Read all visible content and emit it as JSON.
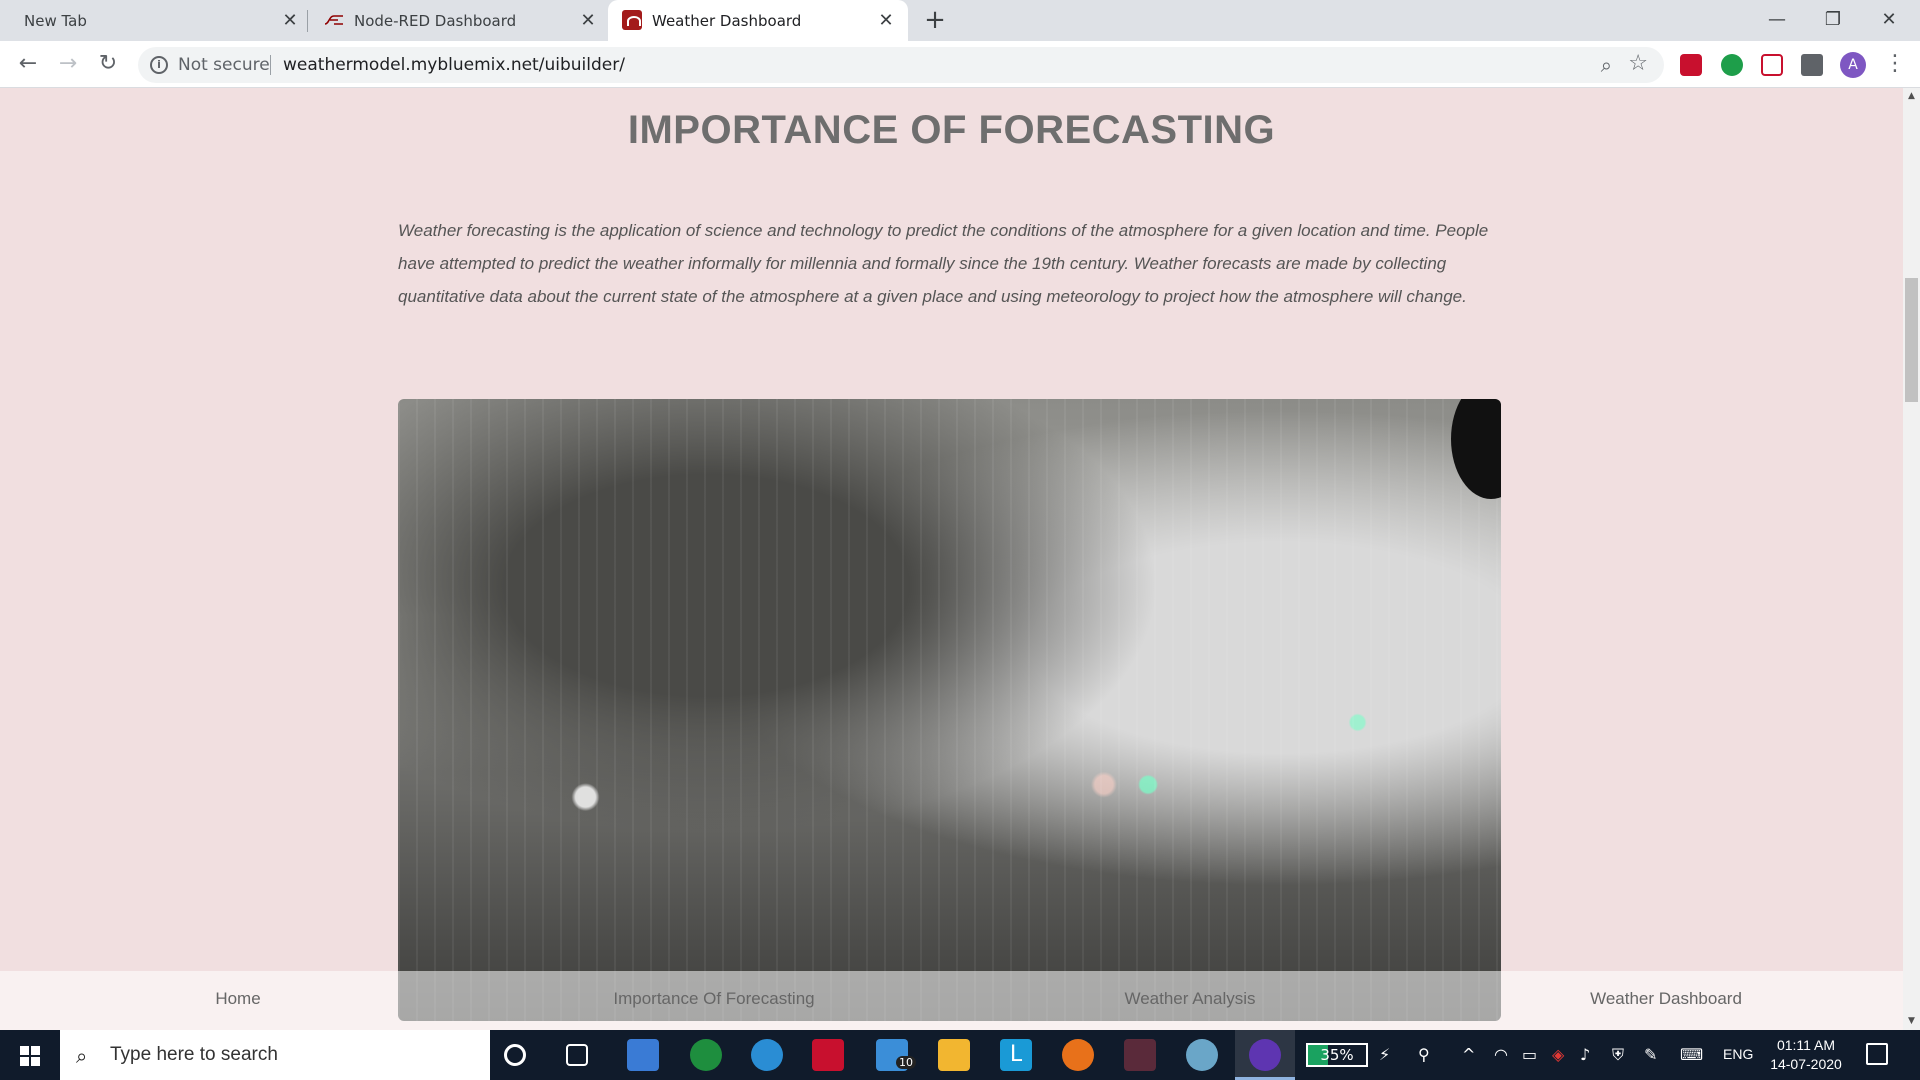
{
  "browser": {
    "tabs": [
      {
        "title": "New Tab"
      },
      {
        "title": "Node-RED Dashboard"
      },
      {
        "title": "Weather Dashboard",
        "active": true
      }
    ],
    "security_label": "Not secure",
    "url": "weathermodel.mybluemix.net/uibuilder/",
    "profile_initial": "A"
  },
  "page": {
    "heading": "IMPORTANCE OF FORECASTING",
    "paragraph": "Weather forecasting is the application of science and technology to predict the conditions of the atmosphere for a given location and time. People have attempted to predict the weather informally for millennia and formally since the 19th century. Weather forecasts are made by collecting quantitative data about the current state of the atmosphere at a given place and using meteorology to project how the atmosphere will change.",
    "nav": [
      "Home",
      "Importance Of Forecasting",
      "Weather Analysis",
      "Weather Dashboard"
    ]
  },
  "taskbar": {
    "search_placeholder": "Type here to search",
    "mail_badge": "10",
    "battery_percent": "35%",
    "battery_level": 0.35,
    "language": "ENG",
    "time": "01:11 AM",
    "date": "14-07-2020"
  },
  "colors": {
    "page_background": "#f1dfe0",
    "accent_red": "#a31b1b",
    "taskbar": "#101b2b"
  }
}
